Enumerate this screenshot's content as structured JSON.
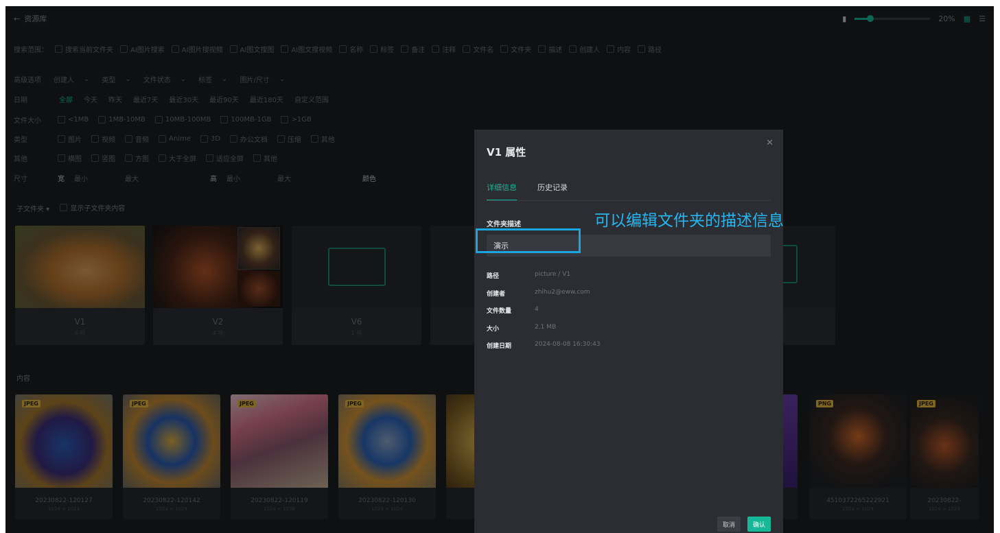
{
  "topbar": {
    "back_icon": "arrow-left-icon",
    "title": "资源库",
    "zoom": "20%"
  },
  "filters": {
    "scope": {
      "label": "搜索范围：",
      "options": [
        "搜索当前文件夹",
        "AI图片搜索",
        "AI图片搜视频",
        "AI图文搜图",
        "AI图文搜视频",
        "名称",
        "标签",
        "备注",
        "注释",
        "文件名",
        "文件夹",
        "描述",
        "创建人",
        "内容",
        "路径"
      ]
    },
    "attrs": {
      "label": "高级选项",
      "selects": [
        "创建人",
        "类型",
        "文件状态",
        "标签",
        "图片/尺寸"
      ]
    },
    "date": {
      "label": "日期",
      "options": [
        "全部",
        "今天",
        "昨天",
        "最近7天",
        "最近30天",
        "最近90天",
        "最近180天",
        "自定义范围"
      ],
      "active": "全部"
    },
    "size": {
      "label": "文件大小",
      "options": [
        "<1MB",
        "1MB-10MB",
        "10MB-100MB",
        "100MB-1GB",
        ">1GB"
      ]
    },
    "kind": {
      "label": "类型",
      "options": [
        "图片",
        "视频",
        "音频",
        "Anime",
        "3D",
        "办公文档",
        "压缩",
        "其他"
      ]
    },
    "other": {
      "label": "其他",
      "options": [
        "横图",
        "竖图",
        "方图",
        "大于全屏",
        "适应全屏",
        "其他"
      ]
    },
    "dims": {
      "label": "尺寸",
      "w_label": "宽",
      "h_label": "高",
      "min_ph": "最小",
      "max_ph": "最大",
      "color_label": "颜色"
    }
  },
  "subfolders": {
    "title": "子文件夹 ▾",
    "toggle": "显示子文件夹内容",
    "items": [
      {
        "name": "V1",
        "sub": "4 项"
      },
      {
        "name": "V2",
        "sub": "4 项"
      },
      {
        "name": "V6",
        "sub": "1 项"
      }
    ]
  },
  "content": {
    "title": "内容",
    "items": [
      {
        "fmt": "JPEG",
        "name": "20230822-120127",
        "dims": "1024 × 1024"
      },
      {
        "fmt": "JPEG",
        "name": "20230822-120142",
        "dims": "1024 × 1024"
      },
      {
        "fmt": "JPEG",
        "name": "20230822-120119",
        "dims": "1024 × 1536"
      },
      {
        "fmt": "JPEG",
        "name": "20230822-120130",
        "dims": "1024 × 1024"
      },
      {
        "fmt": "PNG",
        "name": "4510372265222921",
        "dims": "1024 × 1024"
      },
      {
        "fmt": "JPEG",
        "name": "20230822-",
        "dims": "1024 × 1024"
      }
    ]
  },
  "dialog": {
    "title": "V1 属性",
    "tabs": [
      "详细信息",
      "历史记录"
    ],
    "desc_label": "文件夹描述",
    "desc_value": "演示",
    "props": [
      {
        "k": "路径",
        "v": "picture / V1"
      },
      {
        "k": "创建者",
        "v": "zhihu2@eww.com"
      },
      {
        "k": "文件数量",
        "v": "4"
      },
      {
        "k": "大小",
        "v": "2.1 MB"
      },
      {
        "k": "创建日期",
        "v": "2024-08-08 16:30:43"
      }
    ],
    "cancel": "取消",
    "ok": "确认"
  },
  "annotation": "可以编辑文件夹的描述信息",
  "colors": {
    "accent": "#17b897",
    "annotation": "#27b6ef",
    "bg": "#1c1e22"
  }
}
